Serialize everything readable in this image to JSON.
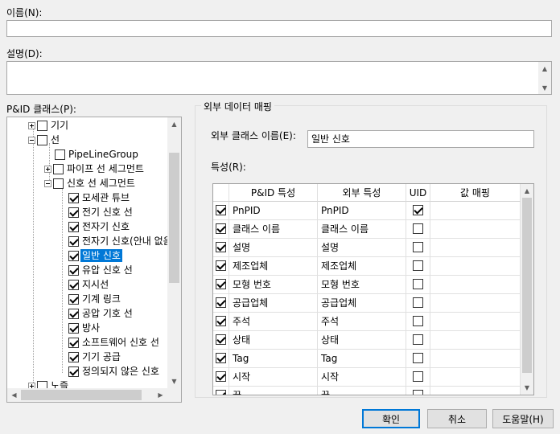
{
  "name": {
    "label": "이름(N):",
    "value": ""
  },
  "description": {
    "label": "설명(D):",
    "value": ""
  },
  "pid_classes": {
    "label": "P&ID 클래스(P):",
    "tree": [
      {
        "label": "기기",
        "checked": false,
        "expander": "plus"
      },
      {
        "label": "선",
        "checked": false,
        "expander": "minus"
      },
      {
        "label": "PipeLineGroup",
        "checked": false,
        "expander": "none"
      },
      {
        "label": "파이프 선 세그먼트",
        "checked": false,
        "expander": "plus"
      },
      {
        "label": "신호 선 세그먼트",
        "checked": false,
        "expander": "minus"
      },
      {
        "label": "모세관 튜브",
        "checked": true
      },
      {
        "label": "전기 신호 선",
        "checked": true
      },
      {
        "label": "전자기 신호",
        "checked": true
      },
      {
        "label": "전자기 신호(안내 없음)",
        "checked": true
      },
      {
        "label": "일반 신호",
        "checked": true,
        "selected": true
      },
      {
        "label": "유압 신호 선",
        "checked": true
      },
      {
        "label": "지시선",
        "checked": true
      },
      {
        "label": "기계 링크",
        "checked": true
      },
      {
        "label": "공압 기호 선",
        "checked": true
      },
      {
        "label": "방사",
        "checked": true
      },
      {
        "label": "소프트웨어 신호 선",
        "checked": true
      },
      {
        "label": "기기 공급",
        "checked": true
      },
      {
        "label": "정의되지 않은 신호",
        "checked": true
      },
      {
        "label": "노즐",
        "checked": false,
        "expander": "plus"
      }
    ]
  },
  "mapping": {
    "group_title": "외부 데이터 매핑",
    "ext_class_label": "외부 클래스 이름(E):",
    "ext_class_value": "일반 신호",
    "props_label": "특성(R):",
    "columns": {
      "pid": "P&ID 특성",
      "ext": "외부 특성",
      "uid": "UID",
      "value_map": "값 매핑"
    },
    "rows": [
      {
        "checked": true,
        "pid": "PnPID",
        "ext": "PnPID",
        "uid": true
      },
      {
        "checked": true,
        "pid": "클래스 이름",
        "ext": "클래스 이름",
        "uid": false
      },
      {
        "checked": true,
        "pid": "설명",
        "ext": "설명",
        "uid": false
      },
      {
        "checked": true,
        "pid": "제조업체",
        "ext": "제조업체",
        "uid": false
      },
      {
        "checked": true,
        "pid": "모형 번호",
        "ext": "모형 번호",
        "uid": false
      },
      {
        "checked": true,
        "pid": "공급업체",
        "ext": "공급업체",
        "uid": false
      },
      {
        "checked": true,
        "pid": "주석",
        "ext": "주석",
        "uid": false
      },
      {
        "checked": true,
        "pid": "상태",
        "ext": "상태",
        "uid": false
      },
      {
        "checked": true,
        "pid": "Tag",
        "ext": "Tag",
        "uid": false
      },
      {
        "checked": true,
        "pid": "시작",
        "ext": "시작",
        "uid": false
      },
      {
        "checked": true,
        "pid": "끝",
        "ext": "끝",
        "uid": false
      }
    ]
  },
  "buttons": {
    "ok": "확인",
    "cancel": "취소",
    "help": "도움말(H)"
  },
  "colors": {
    "selection": "#0078d7",
    "default_button_border": "#0078d7"
  }
}
